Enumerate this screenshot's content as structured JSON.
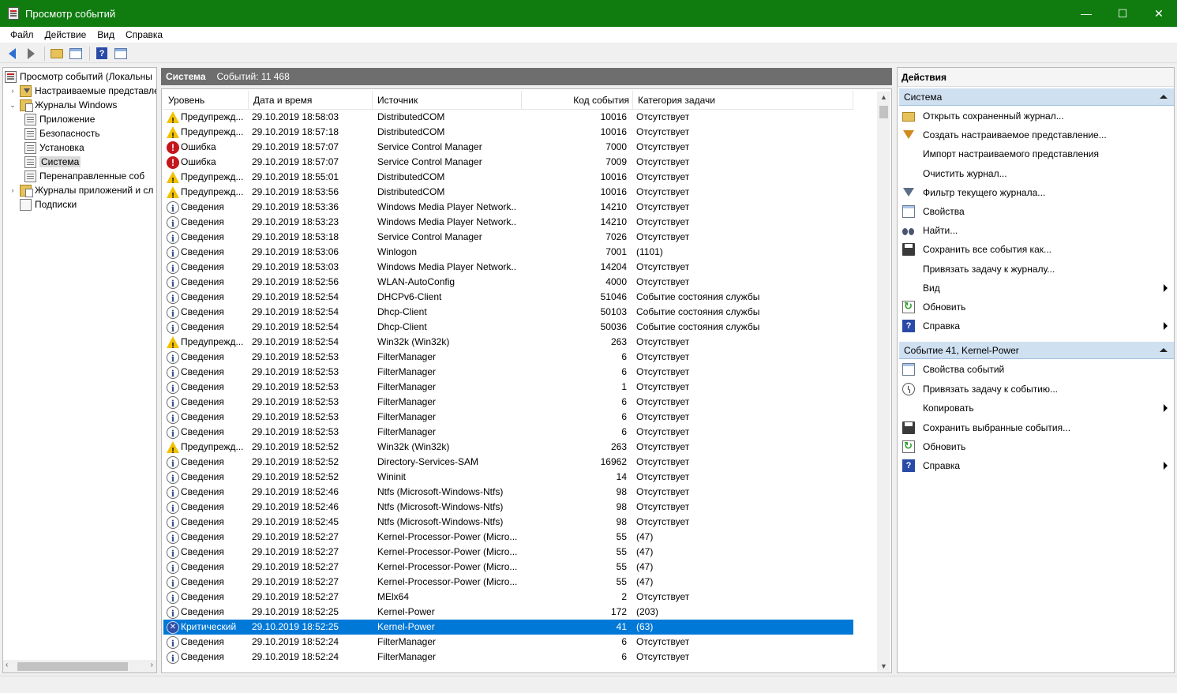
{
  "window": {
    "title": "Просмотр событий",
    "minimize": "—",
    "maximize": "☐",
    "close": "✕"
  },
  "menu": [
    "Файл",
    "Действие",
    "Вид",
    "Справка"
  ],
  "toolbar": {
    "help_glyph": "?"
  },
  "tree": [
    {
      "label": "Просмотр событий (Локальны",
      "icon": "event-viewer-icon",
      "indent": 0,
      "expander": ""
    },
    {
      "label": "Настраиваемые представле",
      "icon": "custom-views-folder-icon",
      "indent": 1,
      "expander": "›"
    },
    {
      "label": "Журналы Windows",
      "icon": "windows-logs-folder-icon",
      "indent": 1,
      "expander": "⌄"
    },
    {
      "label": "Приложение",
      "icon": "log-icon",
      "indent": 2,
      "expander": ""
    },
    {
      "label": "Безопасность",
      "icon": "log-icon",
      "indent": 2,
      "expander": ""
    },
    {
      "label": "Установка",
      "icon": "log-icon",
      "indent": 2,
      "expander": ""
    },
    {
      "label": "Система",
      "icon": "log-icon",
      "indent": 2,
      "expander": "",
      "selected": true
    },
    {
      "label": "Перенаправленные соб",
      "icon": "log-icon",
      "indent": 2,
      "expander": ""
    },
    {
      "label": "Журналы приложений и сл",
      "icon": "app-logs-folder-icon",
      "indent": 1,
      "expander": "›"
    },
    {
      "label": "Подписки",
      "icon": "subscriptions-icon",
      "indent": 1,
      "expander": ""
    }
  ],
  "center": {
    "log_name": "Система",
    "event_count": "Событий: 11 468",
    "columns": [
      "Уровень",
      "Дата и время",
      "Источник",
      "Код события",
      "Категория задачи"
    ],
    "rows": [
      {
        "level": "warn",
        "level_label": "Предупрежд...",
        "date": "29.10.2019 18:58:03",
        "source": "DistributedCOM",
        "code": "10016",
        "category": "Отсутствует"
      },
      {
        "level": "warn",
        "level_label": "Предупрежд...",
        "date": "29.10.2019 18:57:18",
        "source": "DistributedCOM",
        "code": "10016",
        "category": "Отсутствует"
      },
      {
        "level": "err",
        "level_label": "Ошибка",
        "date": "29.10.2019 18:57:07",
        "source": "Service Control Manager",
        "code": "7000",
        "category": "Отсутствует"
      },
      {
        "level": "err",
        "level_label": "Ошибка",
        "date": "29.10.2019 18:57:07",
        "source": "Service Control Manager",
        "code": "7009",
        "category": "Отсутствует"
      },
      {
        "level": "warn",
        "level_label": "Предупрежд...",
        "date": "29.10.2019 18:55:01",
        "source": "DistributedCOM",
        "code": "10016",
        "category": "Отсутствует"
      },
      {
        "level": "warn",
        "level_label": "Предупрежд...",
        "date": "29.10.2019 18:53:56",
        "source": "DistributedCOM",
        "code": "10016",
        "category": "Отсутствует"
      },
      {
        "level": "info",
        "level_label": "Сведения",
        "date": "29.10.2019 18:53:36",
        "source": "Windows Media Player Network...",
        "code": "14210",
        "category": "Отсутствует"
      },
      {
        "level": "info",
        "level_label": "Сведения",
        "date": "29.10.2019 18:53:23",
        "source": "Windows Media Player Network...",
        "code": "14210",
        "category": "Отсутствует"
      },
      {
        "level": "info",
        "level_label": "Сведения",
        "date": "29.10.2019 18:53:18",
        "source": "Service Control Manager",
        "code": "7026",
        "category": "Отсутствует"
      },
      {
        "level": "info",
        "level_label": "Сведения",
        "date": "29.10.2019 18:53:06",
        "source": "Winlogon",
        "code": "7001",
        "category": "(1101)"
      },
      {
        "level": "info",
        "level_label": "Сведения",
        "date": "29.10.2019 18:53:03",
        "source": "Windows Media Player Network...",
        "code": "14204",
        "category": "Отсутствует"
      },
      {
        "level": "info",
        "level_label": "Сведения",
        "date": "29.10.2019 18:52:56",
        "source": "WLAN-AutoConfig",
        "code": "4000",
        "category": "Отсутствует"
      },
      {
        "level": "info",
        "level_label": "Сведения",
        "date": "29.10.2019 18:52:54",
        "source": "DHCPv6-Client",
        "code": "51046",
        "category": "Событие состояния службы"
      },
      {
        "level": "info",
        "level_label": "Сведения",
        "date": "29.10.2019 18:52:54",
        "source": "Dhcp-Client",
        "code": "50103",
        "category": "Событие состояния службы"
      },
      {
        "level": "info",
        "level_label": "Сведения",
        "date": "29.10.2019 18:52:54",
        "source": "Dhcp-Client",
        "code": "50036",
        "category": "Событие состояния службы"
      },
      {
        "level": "warn",
        "level_label": "Предупрежд...",
        "date": "29.10.2019 18:52:54",
        "source": "Win32k (Win32k)",
        "code": "263",
        "category": "Отсутствует"
      },
      {
        "level": "info",
        "level_label": "Сведения",
        "date": "29.10.2019 18:52:53",
        "source": "FilterManager",
        "code": "6",
        "category": "Отсутствует"
      },
      {
        "level": "info",
        "level_label": "Сведения",
        "date": "29.10.2019 18:52:53",
        "source": "FilterManager",
        "code": "6",
        "category": "Отсутствует"
      },
      {
        "level": "info",
        "level_label": "Сведения",
        "date": "29.10.2019 18:52:53",
        "source": "FilterManager",
        "code": "1",
        "category": "Отсутствует"
      },
      {
        "level": "info",
        "level_label": "Сведения",
        "date": "29.10.2019 18:52:53",
        "source": "FilterManager",
        "code": "6",
        "category": "Отсутствует"
      },
      {
        "level": "info",
        "level_label": "Сведения",
        "date": "29.10.2019 18:52:53",
        "source": "FilterManager",
        "code": "6",
        "category": "Отсутствует"
      },
      {
        "level": "info",
        "level_label": "Сведения",
        "date": "29.10.2019 18:52:53",
        "source": "FilterManager",
        "code": "6",
        "category": "Отсутствует"
      },
      {
        "level": "warn",
        "level_label": "Предупрежд...",
        "date": "29.10.2019 18:52:52",
        "source": "Win32k (Win32k)",
        "code": "263",
        "category": "Отсутствует"
      },
      {
        "level": "info",
        "level_label": "Сведения",
        "date": "29.10.2019 18:52:52",
        "source": "Directory-Services-SAM",
        "code": "16962",
        "category": "Отсутствует"
      },
      {
        "level": "info",
        "level_label": "Сведения",
        "date": "29.10.2019 18:52:52",
        "source": "Wininit",
        "code": "14",
        "category": "Отсутствует"
      },
      {
        "level": "info",
        "level_label": "Сведения",
        "date": "29.10.2019 18:52:46",
        "source": "Ntfs (Microsoft-Windows-Ntfs)",
        "code": "98",
        "category": "Отсутствует"
      },
      {
        "level": "info",
        "level_label": "Сведения",
        "date": "29.10.2019 18:52:46",
        "source": "Ntfs (Microsoft-Windows-Ntfs)",
        "code": "98",
        "category": "Отсутствует"
      },
      {
        "level": "info",
        "level_label": "Сведения",
        "date": "29.10.2019 18:52:45",
        "source": "Ntfs (Microsoft-Windows-Ntfs)",
        "code": "98",
        "category": "Отсутствует"
      },
      {
        "level": "info",
        "level_label": "Сведения",
        "date": "29.10.2019 18:52:27",
        "source": "Kernel-Processor-Power (Micro...",
        "code": "55",
        "category": "(47)"
      },
      {
        "level": "info",
        "level_label": "Сведения",
        "date": "29.10.2019 18:52:27",
        "source": "Kernel-Processor-Power (Micro...",
        "code": "55",
        "category": "(47)"
      },
      {
        "level": "info",
        "level_label": "Сведения",
        "date": "29.10.2019 18:52:27",
        "source": "Kernel-Processor-Power (Micro...",
        "code": "55",
        "category": "(47)"
      },
      {
        "level": "info",
        "level_label": "Сведения",
        "date": "29.10.2019 18:52:27",
        "source": "Kernel-Processor-Power (Micro...",
        "code": "55",
        "category": "(47)"
      },
      {
        "level": "info",
        "level_label": "Сведения",
        "date": "29.10.2019 18:52:27",
        "source": "MElx64",
        "code": "2",
        "category": "Отсутствует"
      },
      {
        "level": "info",
        "level_label": "Сведения",
        "date": "29.10.2019 18:52:25",
        "source": "Kernel-Power",
        "code": "172",
        "category": "(203)"
      },
      {
        "level": "crit",
        "level_label": "Критический",
        "date": "29.10.2019 18:52:25",
        "source": "Kernel-Power",
        "code": "41",
        "category": "(63)",
        "selected": true
      },
      {
        "level": "info",
        "level_label": "Сведения",
        "date": "29.10.2019 18:52:24",
        "source": "FilterManager",
        "code": "6",
        "category": "Отсутствует"
      },
      {
        "level": "info",
        "level_label": "Сведения",
        "date": "29.10.2019 18:52:24",
        "source": "FilterManager",
        "code": "6",
        "category": "Отсутствует"
      }
    ]
  },
  "actions": {
    "title": "Действия",
    "sections": [
      {
        "title": "Система",
        "items": [
          {
            "label": "Открыть сохраненный журнал...",
            "icon": "open-log-icon",
            "submenu": false
          },
          {
            "label": "Создать настраиваемое представление...",
            "icon": "create-view-icon",
            "submenu": false
          },
          {
            "label": "Импорт настраиваемого представления",
            "icon": "",
            "submenu": false
          },
          {
            "label": "Очистить журнал...",
            "icon": "",
            "submenu": false
          },
          {
            "label": "Фильтр текущего журнала...",
            "icon": "filter-icon",
            "submenu": false
          },
          {
            "label": "Свойства",
            "icon": "properties-icon",
            "submenu": false
          },
          {
            "label": "Найти...",
            "icon": "find-icon",
            "submenu": false
          },
          {
            "label": "Сохранить все события как...",
            "icon": "save-icon",
            "submenu": false
          },
          {
            "label": "Привязать задачу к журналу...",
            "icon": "",
            "submenu": false
          },
          {
            "label": "Вид",
            "icon": "",
            "submenu": true
          },
          {
            "label": "Обновить",
            "icon": "refresh-icon",
            "submenu": false
          },
          {
            "label": "Справка",
            "icon": "help-icon",
            "submenu": true
          }
        ]
      },
      {
        "title": "Событие 41, Kernel-Power",
        "items": [
          {
            "label": "Свойства событий",
            "icon": "properties-icon",
            "submenu": false
          },
          {
            "label": "Привязать задачу к событию...",
            "icon": "task-icon",
            "submenu": false
          },
          {
            "label": "Копировать",
            "icon": "",
            "submenu": true
          },
          {
            "label": "Сохранить выбранные события...",
            "icon": "save-icon",
            "submenu": false
          },
          {
            "label": "Обновить",
            "icon": "refresh-icon",
            "submenu": false
          },
          {
            "label": "Справка",
            "icon": "help-icon",
            "submenu": true
          }
        ]
      }
    ]
  },
  "colors": {
    "titlebar": "#107c10",
    "selection": "#0078d7",
    "section_header": "#cfe0f1",
    "center_header": "#6e6e6e"
  }
}
